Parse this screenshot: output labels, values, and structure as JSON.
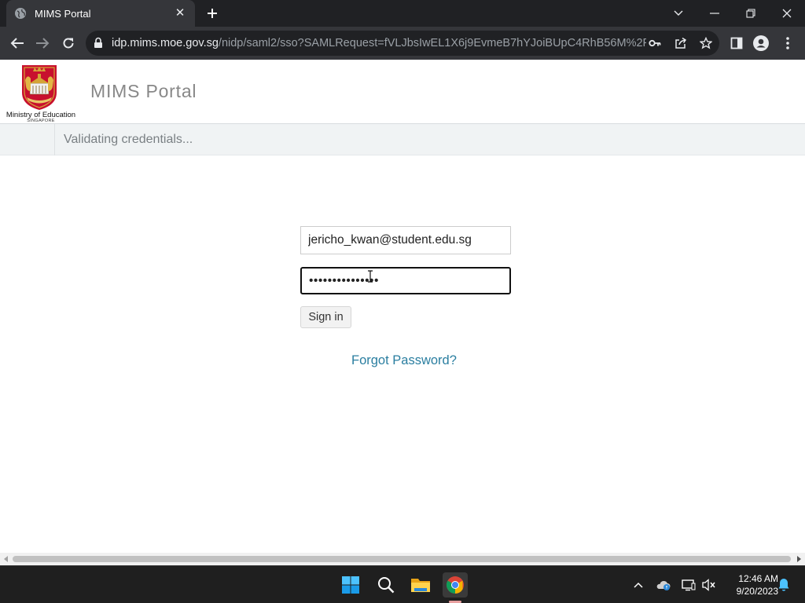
{
  "browser": {
    "tab_title": "MIMS Portal",
    "url_host": "idp.mims.moe.gov.sg",
    "url_path": "/nidp/saml2/sso?SAMLRequest=fVLJbsIwEL1X6j9EvmeB7hYJoiBUpC4RhB56M%2FYku..."
  },
  "header": {
    "logo_text": "Ministry of Education",
    "logo_subtext": "SINGAPORE",
    "portal_title": "MIMS Portal"
  },
  "status": {
    "message": "Validating credentials..."
  },
  "form": {
    "email_value": "jericho_kwan@student.edu.sg",
    "password_value": "•••••••••••••••",
    "signin_label": "Sign in",
    "forgot_label": "Forgot Password?"
  },
  "taskbar": {
    "time": "12:46 AM",
    "date": "9/20/2023"
  },
  "colors": {
    "link": "#2a7ea0",
    "chrome_dark": "#202124",
    "chrome_toolbar": "#35363a"
  }
}
